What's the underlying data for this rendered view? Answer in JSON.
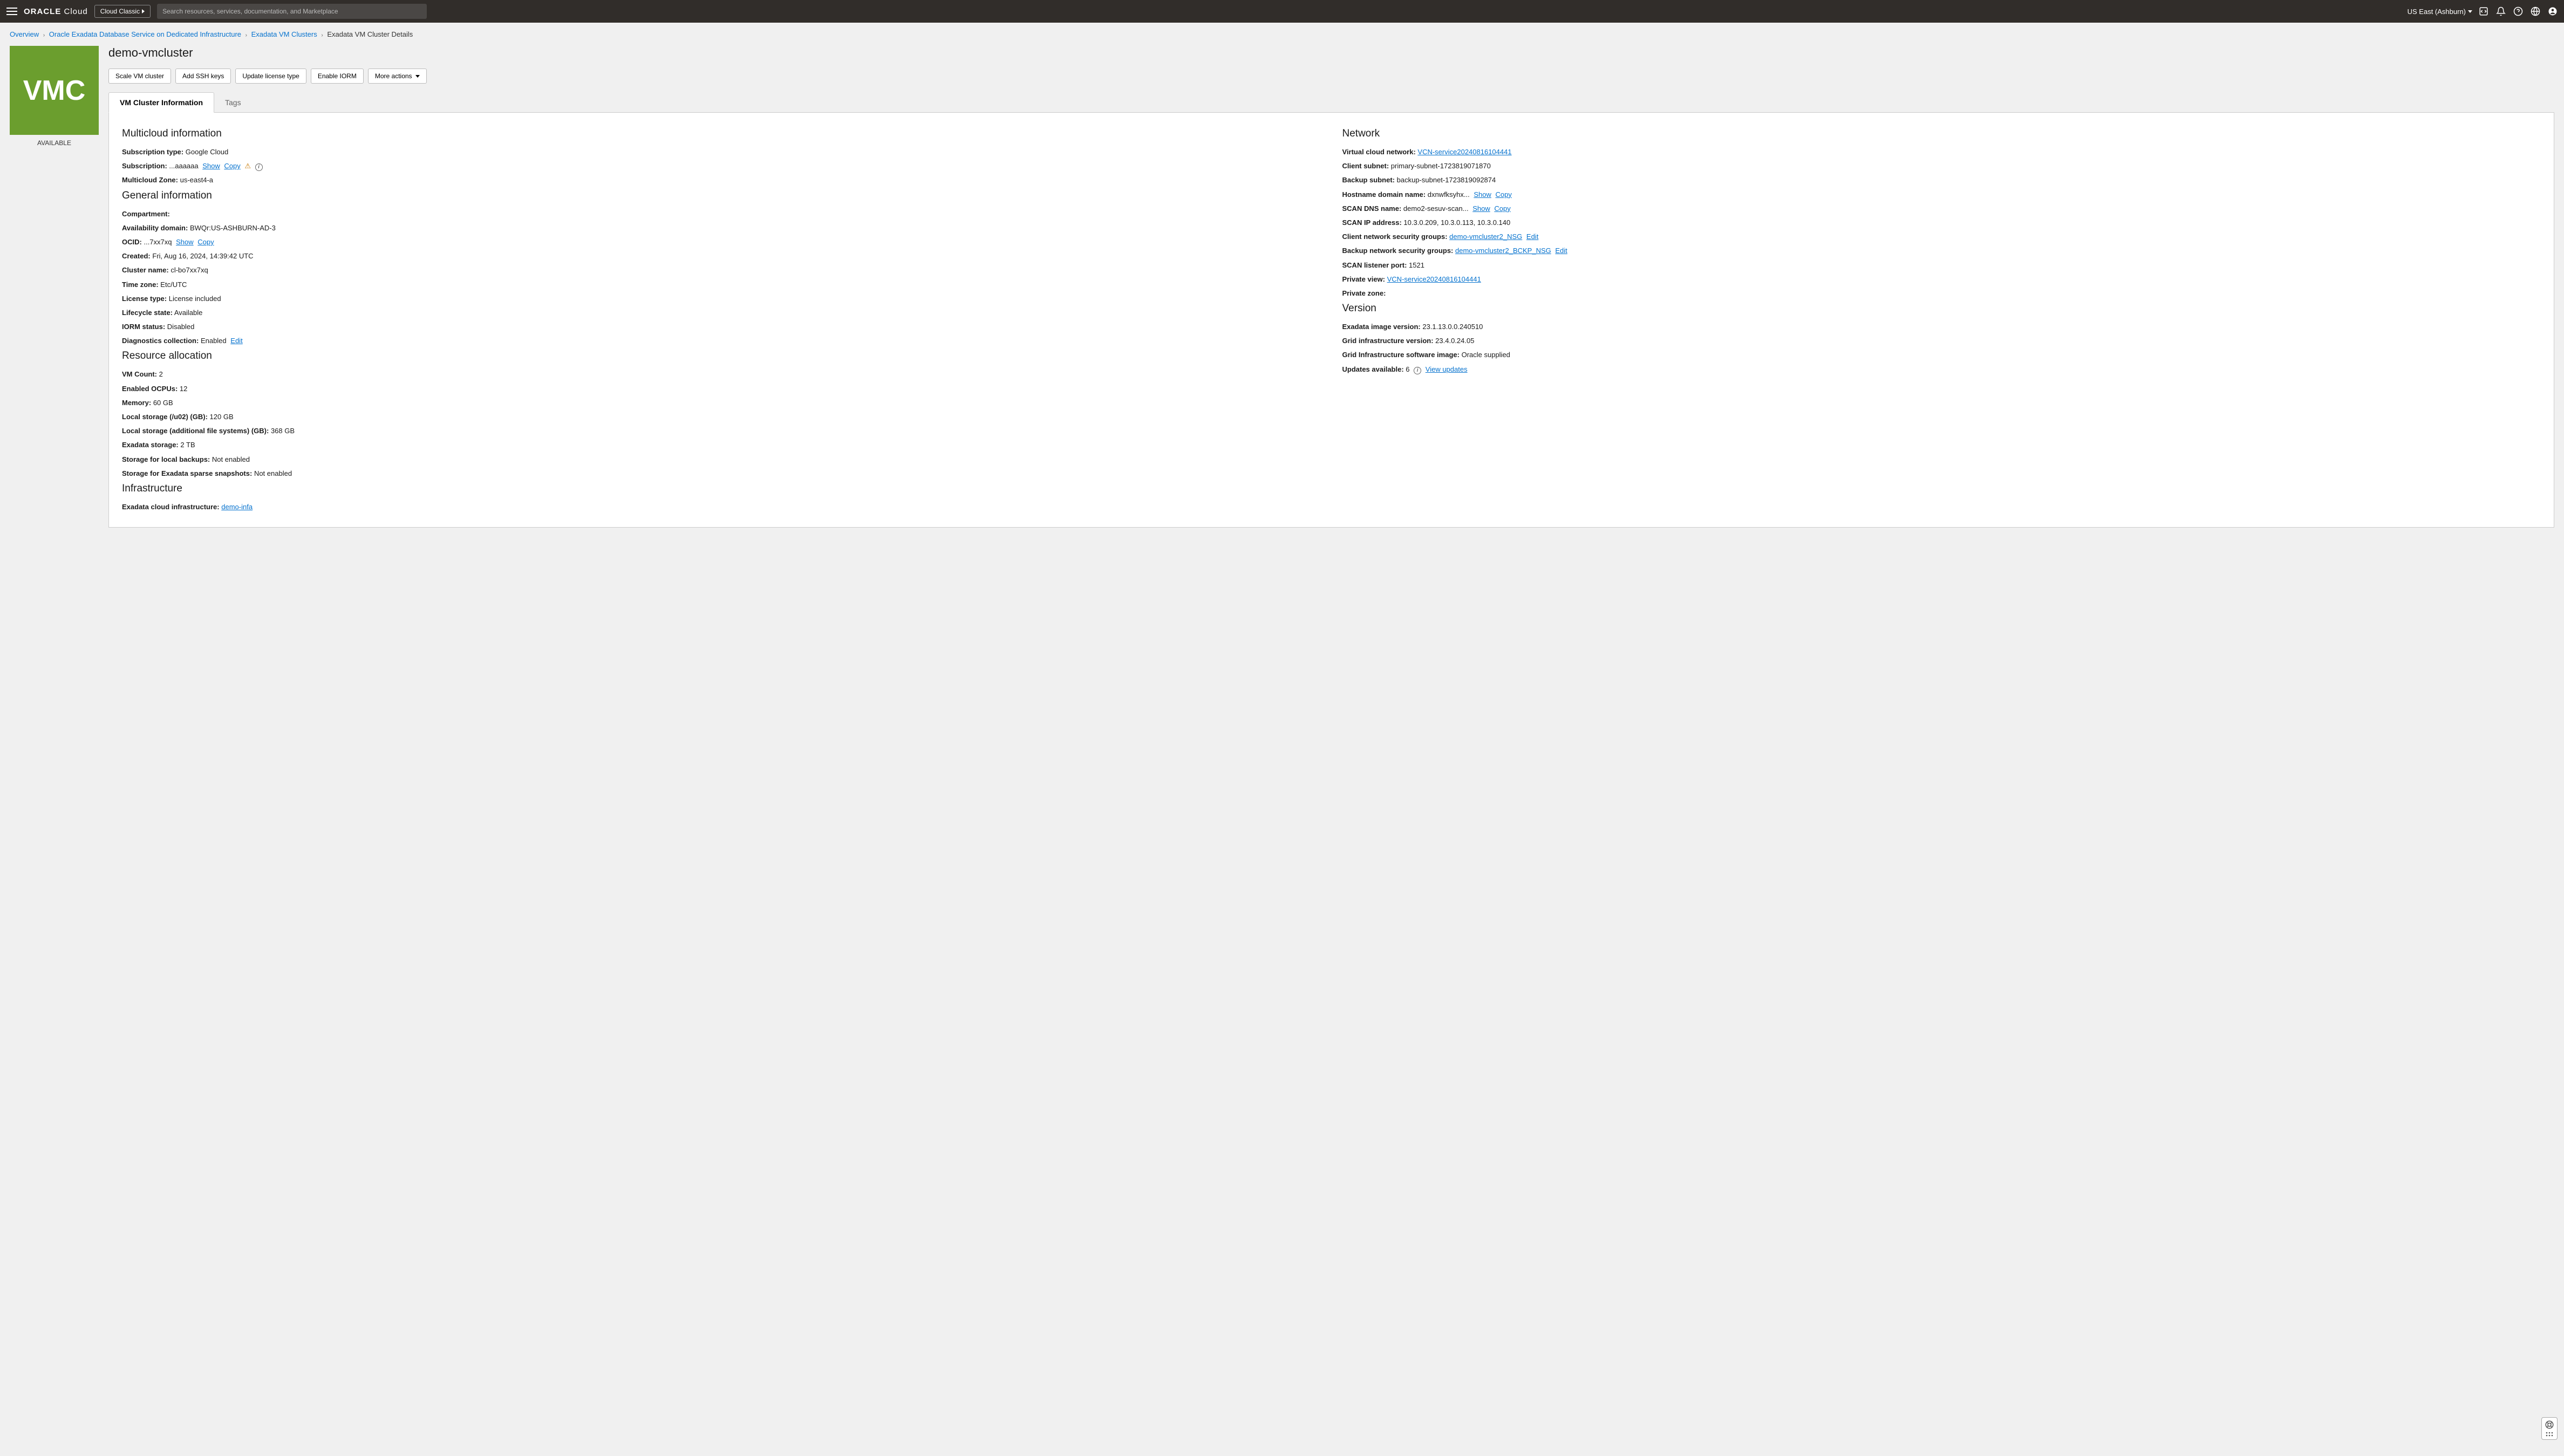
{
  "topbar": {
    "brand_b": "ORACLE",
    "brand_light": " Cloud",
    "cloud_classic_label": "Cloud Classic",
    "search_placeholder": "Search resources, services, documentation, and Marketplace",
    "region_label": "US East (Ashburn)"
  },
  "breadcrumb": {
    "items": [
      {
        "label": "Overview",
        "link": true
      },
      {
        "label": "Oracle Exadata Database Service on Dedicated Infrastructure",
        "link": true
      },
      {
        "label": "Exadata VM Clusters",
        "link": true
      },
      {
        "label": "Exadata VM Cluster Details",
        "link": false
      }
    ]
  },
  "resource": {
    "icon_text": "VMC",
    "status": "AVAILABLE",
    "title": "demo-vmcluster"
  },
  "actions": {
    "scale": "Scale VM cluster",
    "add_ssh": "Add SSH keys",
    "update_license": "Update license type",
    "enable_iorm": "Enable IORM",
    "more": "More actions"
  },
  "tabs": {
    "info": "VM Cluster Information",
    "tags": "Tags"
  },
  "common": {
    "show": "Show",
    "copy": "Copy",
    "edit": "Edit"
  },
  "sections": {
    "multicloud": {
      "title": "Multicloud information",
      "subscription_type_label": "Subscription type:",
      "subscription_type_value": "Google Cloud",
      "subscription_label": "Subscription:",
      "subscription_value": "...aaaaaa",
      "zone_label": "Multicloud Zone:",
      "zone_value": "us-east4-a"
    },
    "general": {
      "title": "General information",
      "compartment_label": "Compartment:",
      "compartment_value": "",
      "ad_label": "Availability domain:",
      "ad_value": "BWQr:US-ASHBURN-AD-3",
      "ocid_label": "OCID:",
      "ocid_value": "...7xx7xq",
      "created_label": "Created:",
      "created_value": "Fri, Aug 16, 2024, 14:39:42 UTC",
      "cluster_name_label": "Cluster name:",
      "cluster_name_value": "cl-bo7xx7xq",
      "timezone_label": "Time zone:",
      "timezone_value": "Etc/UTC",
      "license_label": "License type:",
      "license_value": "License included",
      "lifecycle_label": "Lifecycle state:",
      "lifecycle_value": "Available",
      "iorm_label": "IORM status:",
      "iorm_value": "Disabled",
      "diag_label": "Diagnostics collection:",
      "diag_value": "Enabled"
    },
    "resource_alloc": {
      "title": "Resource allocation",
      "vm_count_label": "VM Count:",
      "vm_count_value": "2",
      "ocpu_label": "Enabled OCPUs:",
      "ocpu_value": "12",
      "memory_label": "Memory:",
      "memory_value": "60 GB",
      "local_u02_label": "Local storage (/u02) (GB):",
      "local_u02_value": "120 GB",
      "local_add_label": "Local storage (additional file systems) (GB):",
      "local_add_value": "368 GB",
      "exa_storage_label": "Exadata storage:",
      "exa_storage_value": "2 TB",
      "local_backup_label": "Storage for local backups:",
      "local_backup_value": "Not enabled",
      "sparse_label": "Storage for Exadata sparse snapshots:",
      "sparse_value": "Not enabled"
    },
    "infra": {
      "title": "Infrastructure",
      "exa_infra_label": "Exadata cloud infrastructure:",
      "exa_infra_link": "demo-infa"
    },
    "network": {
      "title": "Network",
      "vcn_label": "Virtual cloud network:",
      "vcn_link": "VCN-service20240816104441",
      "client_subnet_label": "Client subnet:",
      "client_subnet_value": "primary-subnet-1723819071870",
      "backup_subnet_label": "Backup subnet:",
      "backup_subnet_value": "backup-subnet-1723819092874",
      "host_domain_label": "Hostname domain name:",
      "host_domain_value": "dxnwfksyhx...",
      "scan_dns_label": "SCAN DNS name:",
      "scan_dns_value": "demo2-sesuv-scan...",
      "scan_ip_label": "SCAN IP address:",
      "scan_ip_value": "10.3.0.209, 10.3.0.113, 10.3.0.140",
      "client_nsg_label": "Client network security groups:",
      "client_nsg_link": "demo-vmcluster2_NSG",
      "backup_nsg_label": "Backup network security groups:",
      "backup_nsg_link": "demo-vmcluster2_BCKP_NSG",
      "scan_port_label": "SCAN listener port:",
      "scan_port_value": "1521",
      "private_view_label": "Private view:",
      "private_view_link": "VCN-service20240816104441",
      "private_zone_label": "Private zone:",
      "private_zone_value": ""
    },
    "version": {
      "title": "Version",
      "exa_image_label": "Exadata image version:",
      "exa_image_value": "23.1.13.0.0.240510",
      "grid_ver_label": "Grid infrastructure version:",
      "grid_ver_value": "23.4.0.24.05",
      "grid_sw_label": "Grid Infrastructure software image:",
      "grid_sw_value": "Oracle supplied",
      "updates_label": "Updates available:",
      "updates_value": "6",
      "view_updates": "View updates"
    }
  }
}
